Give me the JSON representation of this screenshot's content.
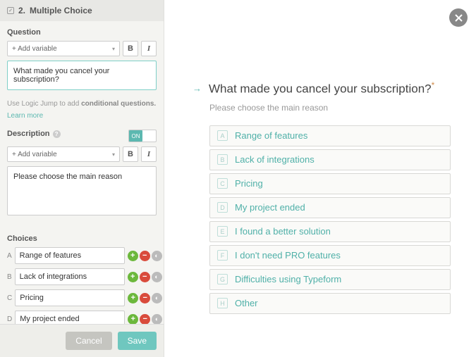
{
  "header": {
    "number": "2.",
    "title": "Multiple Choice"
  },
  "question": {
    "label": "Question",
    "addVariable": "+ Add variable",
    "text": "What made you cancel your subscription?",
    "hint_prefix": "Use Logic Jump to add ",
    "hint_bold": "conditional questions.",
    "learnMore": "Learn more"
  },
  "description": {
    "label": "Description",
    "toggle": "ON",
    "addVariable": "+ Add variable",
    "text": "Please choose the main reason"
  },
  "choices": {
    "label": "Choices",
    "items": [
      {
        "letter": "A",
        "text": "Range of features"
      },
      {
        "letter": "B",
        "text": "Lack of integrations"
      },
      {
        "letter": "C",
        "text": "Pricing"
      },
      {
        "letter": "D",
        "text": "My project ended"
      },
      {
        "letter": "E",
        "text": "I found a better solution"
      }
    ]
  },
  "footer": {
    "cancel": "Cancel",
    "save": "Save"
  },
  "preview": {
    "question": "What made you cancel your subscription?",
    "required": "*",
    "description": "Please choose the main reason",
    "options": [
      {
        "key": "A",
        "label": "Range of features"
      },
      {
        "key": "B",
        "label": "Lack of integrations"
      },
      {
        "key": "C",
        "label": "Pricing"
      },
      {
        "key": "D",
        "label": "My project ended"
      },
      {
        "key": "E",
        "label": "I found a better solution"
      },
      {
        "key": "F",
        "label": "I don't need PRO features"
      },
      {
        "key": "G",
        "label": "Difficulties using Typeform"
      },
      {
        "key": "H",
        "label": "Other"
      }
    ]
  }
}
